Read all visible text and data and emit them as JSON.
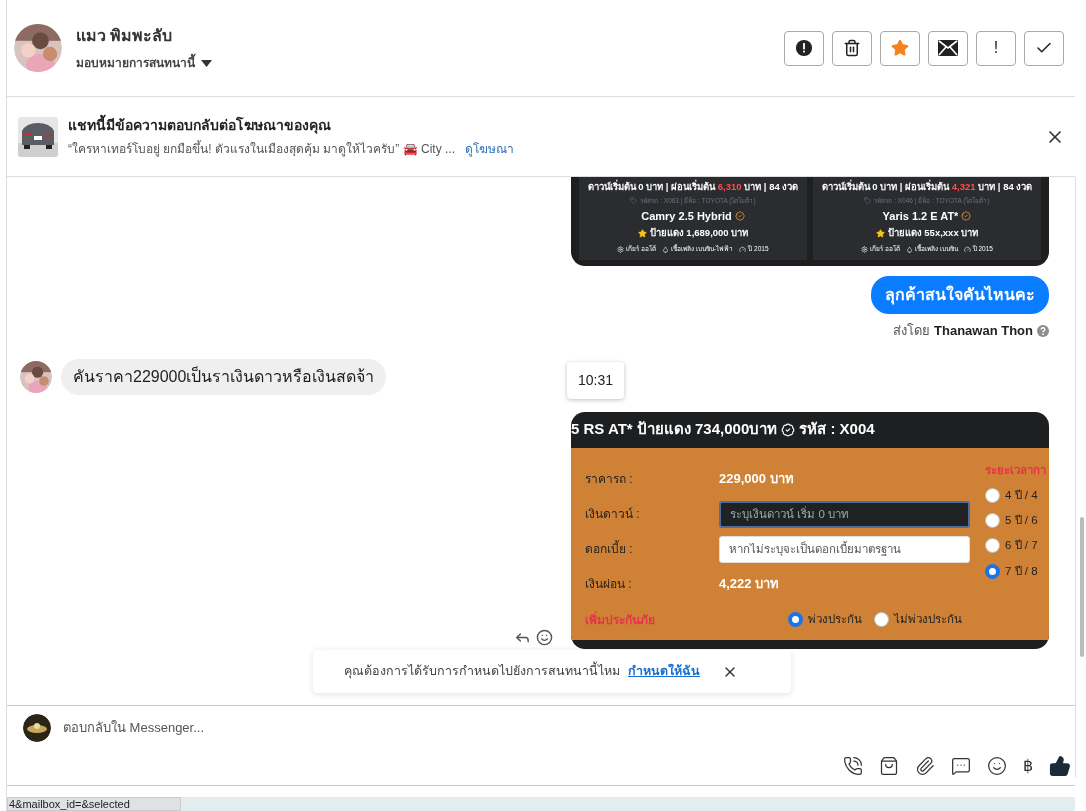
{
  "header": {
    "name": "แมว พิมพะลับ",
    "assign_label": "มอบหมายการสนทนานี้",
    "actions": [
      {
        "kind": "alert",
        "on": false
      },
      {
        "kind": "delete",
        "on": false
      },
      {
        "kind": "star",
        "on": true
      },
      {
        "kind": "mail",
        "on": false
      },
      {
        "kind": "text",
        "label": "!",
        "on": false
      },
      {
        "kind": "done",
        "on": false
      }
    ]
  },
  "ad_banner": {
    "title": "แชทนี้มีข้อความตอบกลับต่อโฆษณาของคุณ",
    "quote": "“ใครหาเทอร์โบอยู่ ยกมือขึ้น! ตัวแรงในเมืองสุดคุ้ม มาดูให้ไวครับ” 🚘 City ...",
    "link": "ดูโฆษณา"
  },
  "listing_image": {
    "cards": [
      {
        "down_prefix": "ดาวน์เริ่มต้น 0 บาท | ผ่อนเริ่มต้น",
        "installment": "6,310",
        "down_suffix": "บาท | 84 งวด",
        "code_line": "รหัสรถ : X063 | ยี่ห้อ : TOYOTA (โตโยต้า)",
        "model": "Camry 2.5 Hybrid",
        "price": "ป้ายแดง 1,689,000 บาท",
        "specs": [
          "เกียร์ ออโต้",
          "เชื้อเพลิง เบนซิน-ไฟฟ้า",
          "ปี 2015"
        ]
      },
      {
        "down_prefix": "ดาวน์เริ่มต้น 0 บาท | ผ่อนเริ่มต้น",
        "installment": "4,321",
        "down_suffix": "บาท | 84 งวด",
        "code_line": "รหัสรถ : X046 | ยี่ห้อ : TOYOTA (โตโยต้า)",
        "model": "Yaris 1.2 E AT*",
        "price": "ป้ายแดง 55x,xxx บาท",
        "specs": [
          "เกียร์ ออโต้",
          "เชื้อเพลิง เบนซิน",
          "ปี 2015"
        ]
      }
    ]
  },
  "outgoing": {
    "text": "ลุกค้าสนใจคันไหนคะ",
    "sent_by_prefix": "ส่งโดย",
    "sent_by_name": "Thanawan Thon"
  },
  "incoming": {
    "text": "คันราคา229000เป็นราเงินดาวหรือเงินสดจ้า"
  },
  "timestamp": "10:31",
  "calculator_image": {
    "title": "5 RS AT* ป้ายแดง 734,000บาท",
    "code": "รหัส : X004",
    "rows": [
      {
        "kind": "value",
        "label": "ราคารถ :",
        "value": "229,000 บาท"
      },
      {
        "kind": "input",
        "label": "เงินดาวน์ :",
        "placeholder": "ระบุเงินดาวน์ เริ่ม 0 บาท",
        "focused": true
      },
      {
        "kind": "input",
        "label": "ดอกเบี้ย :",
        "placeholder": "หากไม่ระบุจะเป็นดอกเบี้ยมาตรฐาน",
        "focused": false
      },
      {
        "kind": "value",
        "label": "เงินผ่อน :",
        "value": "4,222 บาท"
      }
    ],
    "insurance_label": "เพิ่มประกันภัย",
    "insurance_options": [
      {
        "label": "พ่วงประกัน",
        "selected": true
      },
      {
        "label": "ไม่พ่วงประกัน",
        "selected": false
      }
    ],
    "term_title": "ระยะเวลากา",
    "term_options": [
      {
        "label": "4 ปี / 4",
        "selected": false
      },
      {
        "label": "5 ปี / 6",
        "selected": false
      },
      {
        "label": "6 ปี / 7",
        "selected": false
      },
      {
        "label": "7 ปี / 8",
        "selected": true
      }
    ]
  },
  "notice": {
    "text": "คุณต้องการได้รับการกำหนดไปยังการสนทนานี้ไหม",
    "link": "กำหนดให้ฉัน"
  },
  "composer": {
    "placeholder": "ตอบกลับใน Messenger...",
    "currency_symbol": "฿"
  },
  "status_url": "4&mailbox_id=&selected"
}
